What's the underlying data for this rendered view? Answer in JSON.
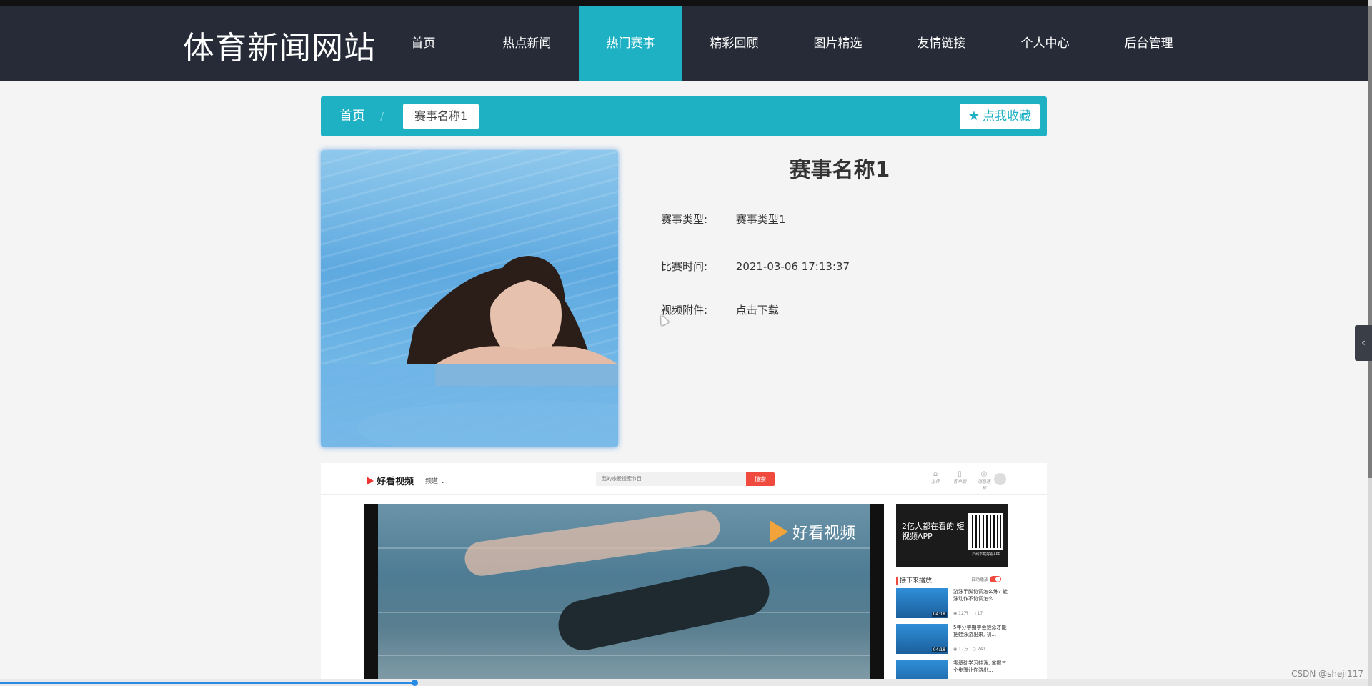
{
  "site": {
    "logo": "体育新闻网站"
  },
  "nav": {
    "items": [
      {
        "label": "首页"
      },
      {
        "label": "热点新闻"
      },
      {
        "label": "热门赛事"
      },
      {
        "label": "精彩回顾"
      },
      {
        "label": "图片精选"
      },
      {
        "label": "友情链接"
      },
      {
        "label": "个人中心"
      },
      {
        "label": "后台管理"
      }
    ],
    "active_index": 2
  },
  "breadcrumb": {
    "home": "首页",
    "separator": "/",
    "current": "赛事名称1",
    "favorite_icon": "star-icon",
    "favorite_label": "点我收藏"
  },
  "detail": {
    "title": "赛事名称1",
    "type_label": "赛事类型:",
    "type_value": "赛事类型1",
    "time_label": "比赛时间:",
    "time_value": "2021-03-06 17:13:37",
    "video_label": "视频附件:",
    "video_value": "点击下载"
  },
  "embed": {
    "logo": "好看视频",
    "category": "频道",
    "search_placeholder": "我的宗爱搜索节目",
    "search_button": "搜索",
    "top_icons": [
      {
        "label": "上传"
      },
      {
        "label": "客户端"
      },
      {
        "label": "消息通知"
      }
    ],
    "watermark": "好看视频",
    "ad_text": "2亿人都在看的 短视频APP",
    "ad_caption": "扫码下载好看APP",
    "next_heading": "接下来播放",
    "autoplay_label": "自动播放",
    "videos": [
      {
        "title": "游泳手脚协调怎么练? 蛙泳动作不协调怎么...",
        "duration": "04:18",
        "views": "12万",
        "comments": "17"
      },
      {
        "title": "5年分学期学会蛙泳才能把蛙泳游出来, 初...",
        "duration": "04:18",
        "views": "17万",
        "comments": "241"
      },
      {
        "title": "零基础学习蛙泳, 掌握三个步骤让你游出...",
        "duration": "",
        "views": "",
        "comments": ""
      }
    ]
  },
  "footer": {
    "watermark": "CSDN @sheji117"
  },
  "colors": {
    "header_bg": "#262b37",
    "accent": "#1eb1c4",
    "page_bg": "#f4f4f4"
  }
}
